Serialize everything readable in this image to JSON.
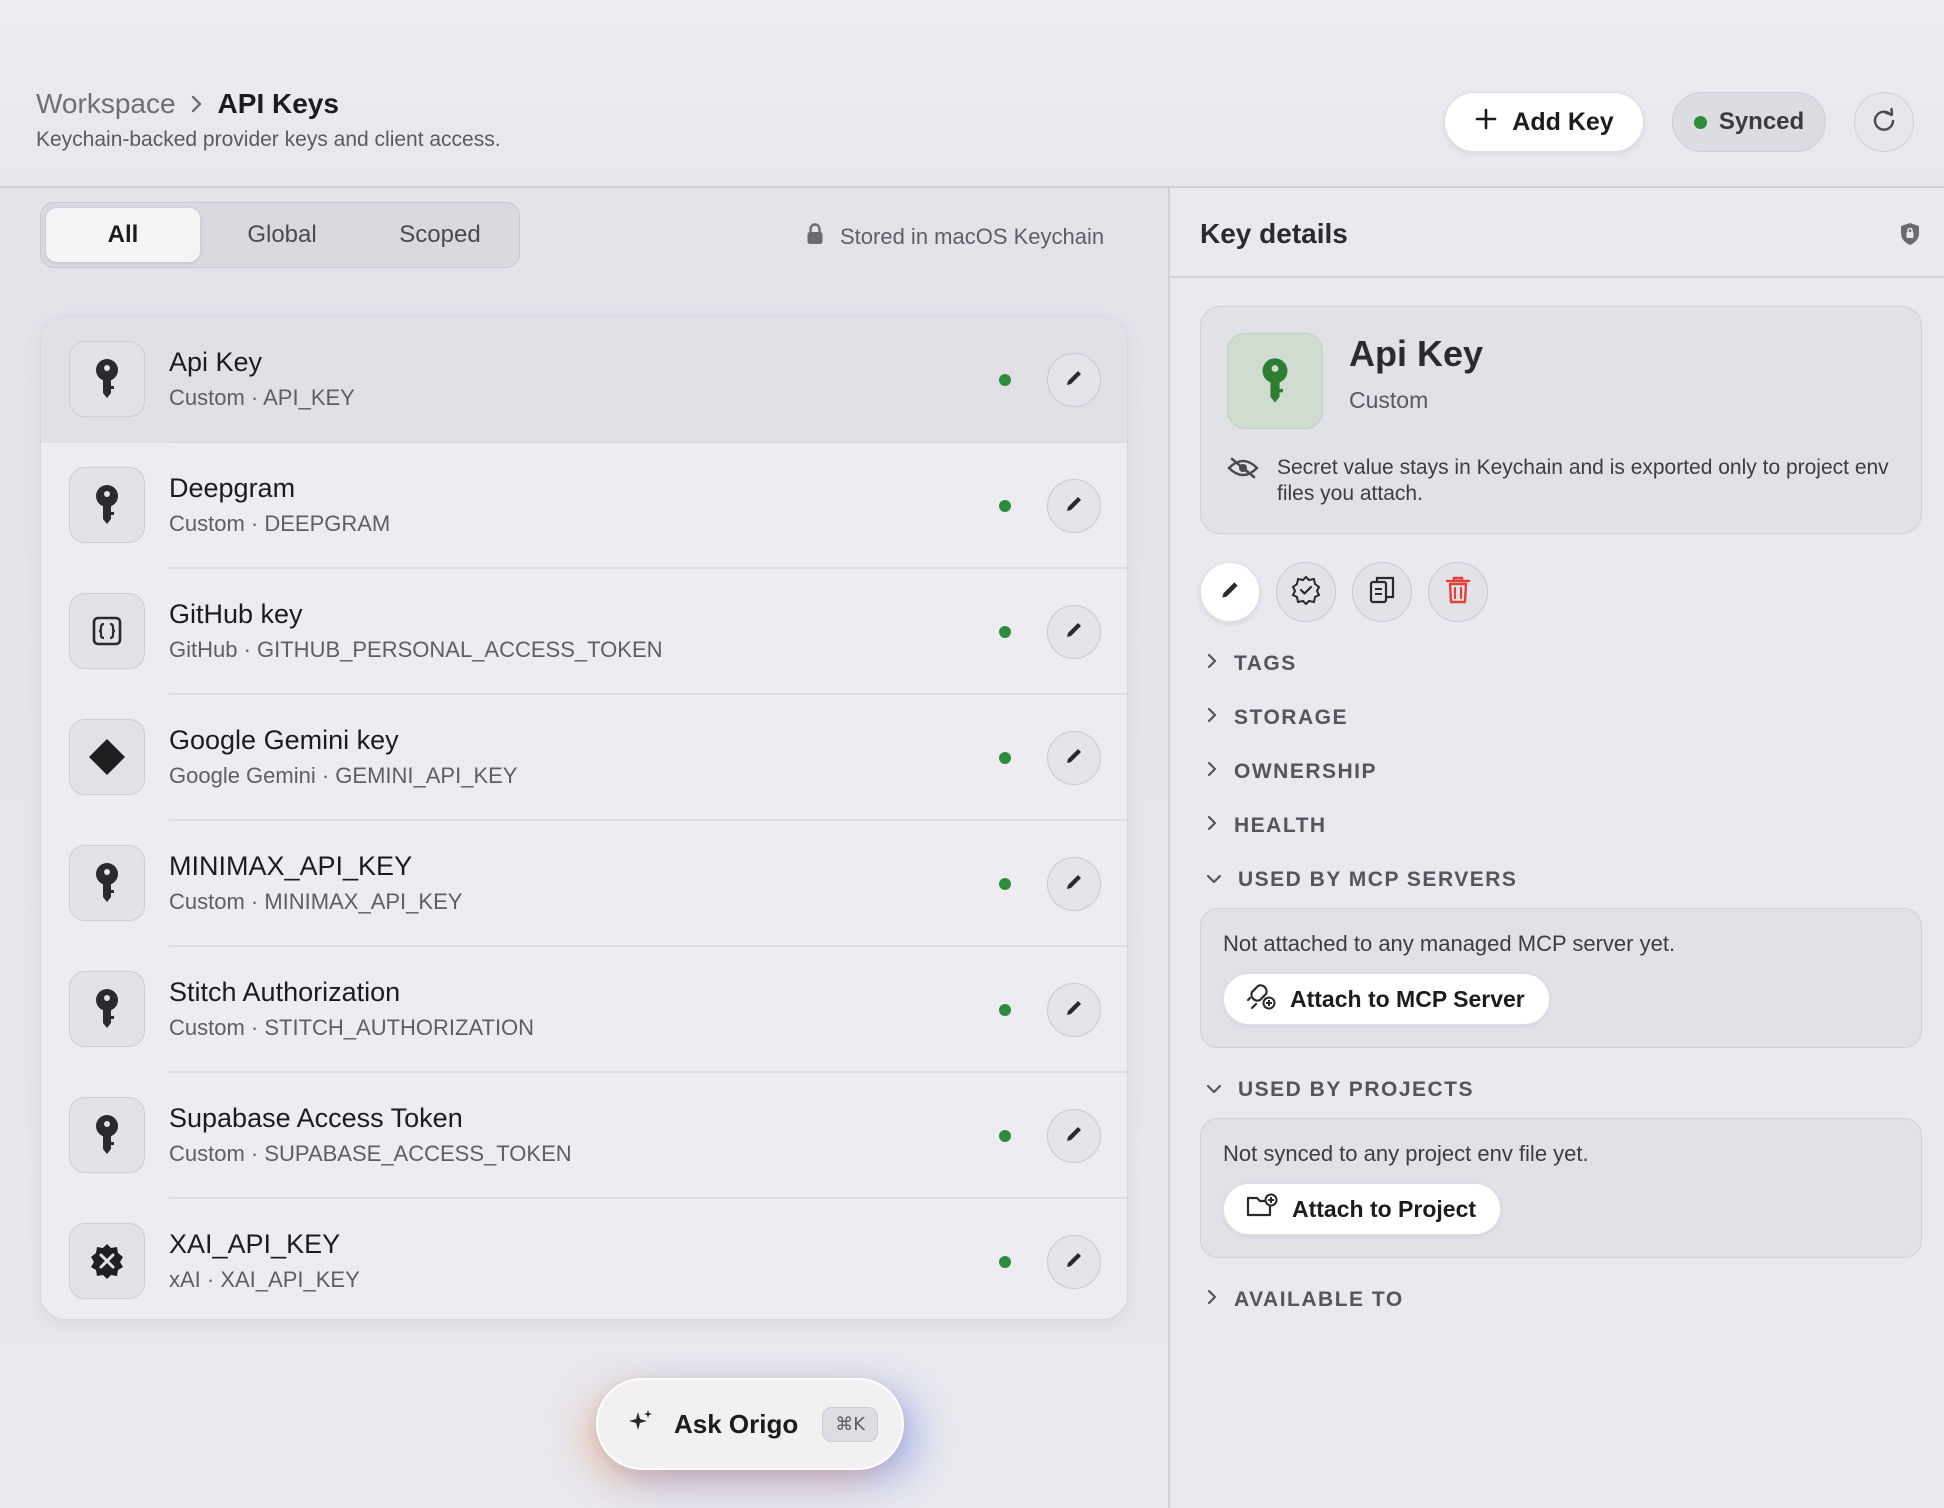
{
  "header": {
    "breadcrumb_root": "Workspace",
    "breadcrumb_current": "API Keys",
    "subtitle": "Keychain-backed provider keys and client access.",
    "add_key_label": "Add Key",
    "synced_label": "Synced"
  },
  "filters": {
    "tabs": [
      {
        "label": "All",
        "active": true
      },
      {
        "label": "Global",
        "active": false
      },
      {
        "label": "Scoped",
        "active": false
      }
    ],
    "storage_note": "Stored in macOS Keychain"
  },
  "keys": [
    {
      "title": "Api Key",
      "subtitle": "Custom · API_KEY",
      "icon": "key-icon",
      "status": "active"
    },
    {
      "title": "Deepgram",
      "subtitle": "Custom · DEEPGRAM",
      "icon": "key-icon",
      "status": "active"
    },
    {
      "title": "GitHub key",
      "subtitle": "GitHub · GITHUB_PERSONAL_ACCESS_TOKEN",
      "icon": "braces-icon",
      "status": "active"
    },
    {
      "title": "Google Gemini key",
      "subtitle": "Google Gemini · GEMINI_API_KEY",
      "icon": "diamond-icon",
      "status": "active"
    },
    {
      "title": "MINIMAX_API_KEY",
      "subtitle": "Custom · MINIMAX_API_KEY",
      "icon": "key-icon",
      "status": "active"
    },
    {
      "title": "Stitch Authorization",
      "subtitle": "Custom · STITCH_AUTHORIZATION",
      "icon": "key-icon",
      "status": "active"
    },
    {
      "title": "Supabase Access Token",
      "subtitle": "Custom · SUPABASE_ACCESS_TOKEN",
      "icon": "key-icon",
      "status": "active"
    },
    {
      "title": "XAI_API_KEY",
      "subtitle": "xAI · XAI_API_KEY",
      "icon": "xai-badge-icon",
      "status": "active"
    }
  ],
  "ask": {
    "label": "Ask Origo",
    "shortcut": "⌘K"
  },
  "details": {
    "title": "Key details",
    "name": "Api Key",
    "kind": "Custom",
    "note": "Secret value stays in Keychain and is exported only to project env files you attach.",
    "sections": {
      "tags": "TAGS",
      "storage": "STORAGE",
      "ownership": "OWNERSHIP",
      "health": "HEALTH",
      "mcp": "USED BY MCP SERVERS",
      "projects": "USED BY PROJECTS",
      "available": "AVAILABLE TO"
    },
    "mcp_text": "Not attached to any managed MCP server yet.",
    "mcp_button": "Attach to MCP Server",
    "projects_text": "Not synced to any project env file yet.",
    "projects_button": "Attach to Project"
  },
  "colors": {
    "status_green": "#2f8a3e",
    "delete_red": "#e0413a",
    "key_green": "#2e7d32"
  }
}
